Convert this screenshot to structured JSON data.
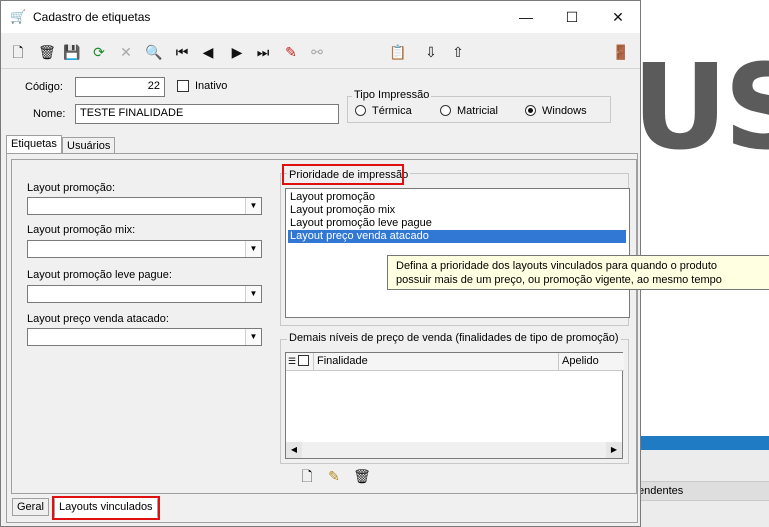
{
  "background": {
    "logo_text": "US",
    "tab_partial": "endentes"
  },
  "window": {
    "title": "Cadastro de etiquetas",
    "controls": {
      "minimize": "—",
      "maximize": "☐",
      "close": "✕"
    }
  },
  "toolbar": {
    "icons": [
      "new-icon",
      "delete-icon",
      "save-icon",
      "refresh-icon",
      "cancel-icon",
      "search-icon",
      "first-icon",
      "prev-icon",
      "next-icon",
      "last-icon",
      "filter-icon",
      "binoculars-icon",
      "report-icon",
      "down-arrow-icon",
      "up-arrow-icon",
      "exit-icon"
    ]
  },
  "form": {
    "codigo_label": "Código:",
    "codigo_value": "22",
    "inativo_label": "Inativo",
    "nome_label": "Nome:",
    "nome_value": "TESTE FINALIDADE",
    "tipo_impressao": {
      "title": "Tipo Impressão",
      "options": [
        "Térmica",
        "Matricial",
        "Windows"
      ],
      "selected": "Windows"
    }
  },
  "tabs": {
    "top": [
      "Etiquetas",
      "Usuários"
    ],
    "active_top": "Etiquetas",
    "bottom": [
      "Geral",
      "Layouts vinculados"
    ],
    "active_bottom": "Layouts vinculados"
  },
  "layouts": {
    "promocao_label": "Layout promoção:",
    "promocao_mix_label": "Layout promoção mix:",
    "promocao_leve_pague_label": "Layout promoção leve pague:",
    "preco_venda_atacado_label": "Layout preço venda atacado:"
  },
  "prioridade": {
    "title": "Prioridade de impressão",
    "items": [
      "Layout promoção",
      "Layout promoção mix",
      "Layout promoção leve pague",
      "Layout preço venda atacado"
    ],
    "selected_index": 3
  },
  "tooltip": {
    "line1": "Defina a prioridade dos layouts vinculados para quando o produto",
    "line2": "possuir mais de um preço, ou promoção vigente, ao mesmo tempo"
  },
  "demais_niveis": {
    "title": "Demais níveis de preço de venda (finalidades de tipo de promoção)",
    "columns": [
      "Finalidade",
      "Apelido"
    ]
  },
  "colors": {
    "selection": "#3078d4",
    "highlight_border": "#e01010",
    "tooltip_bg": "#ffffe1"
  }
}
